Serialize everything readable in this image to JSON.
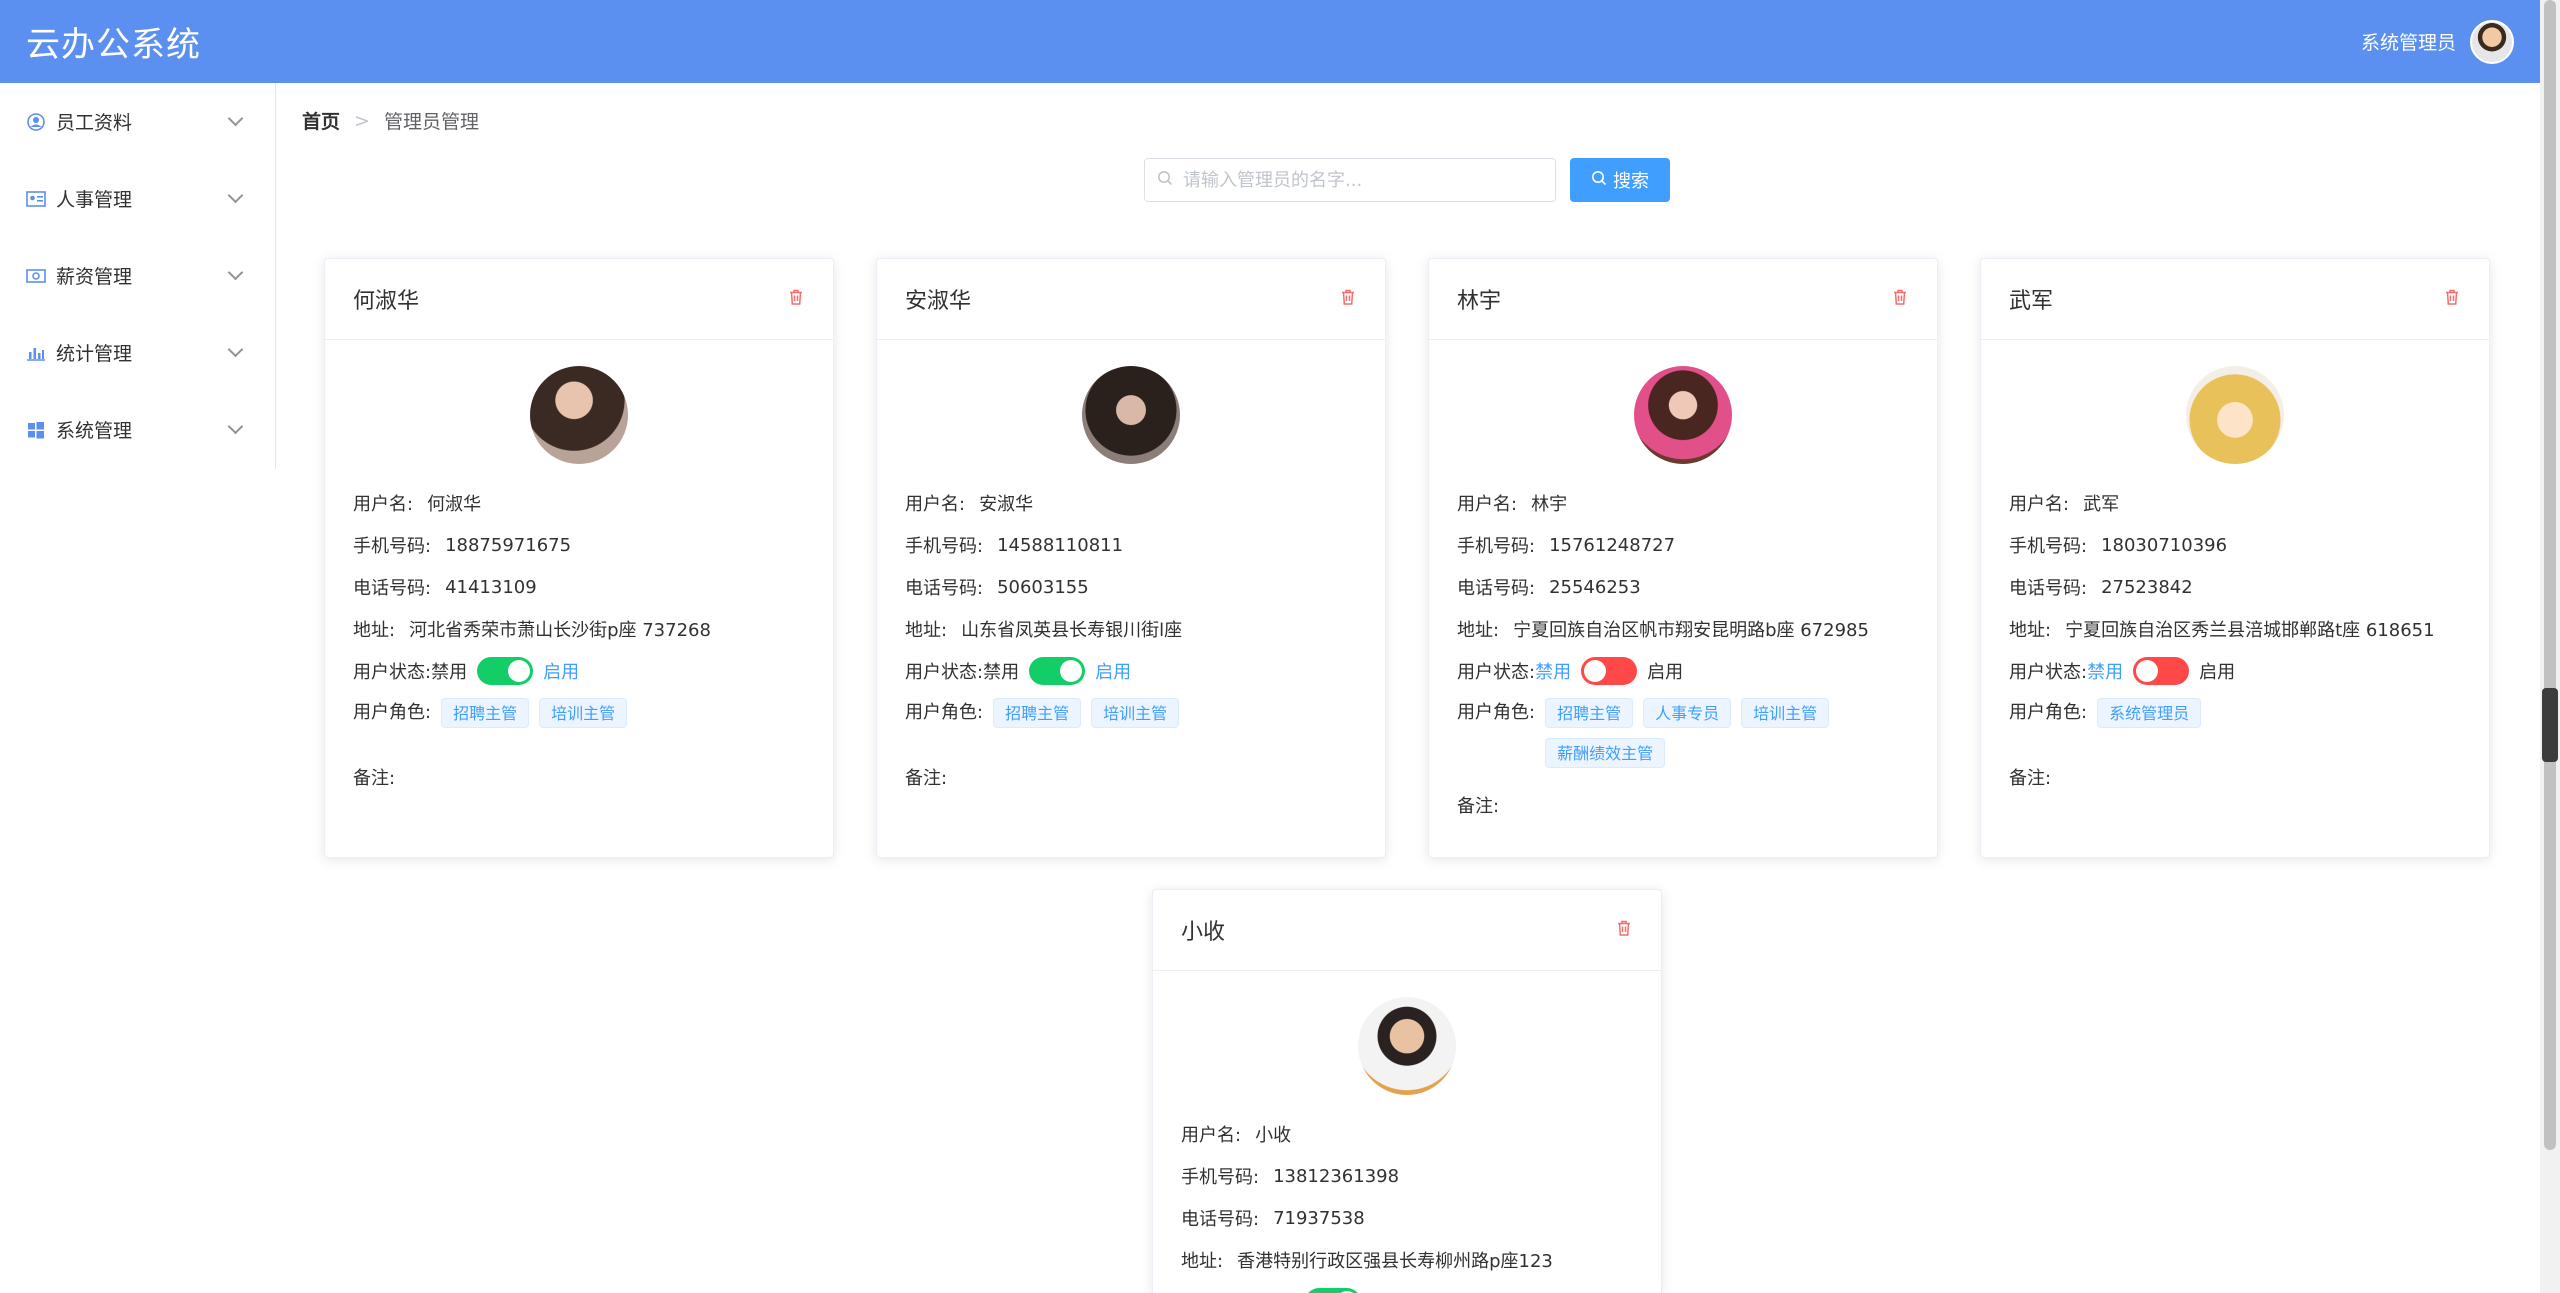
{
  "app": {
    "title": "云办公系统",
    "user_name": "系统管理员"
  },
  "sidebar": {
    "items": [
      {
        "label": "员工资料",
        "icon": "user-circle-icon"
      },
      {
        "label": "人事管理",
        "icon": "id-card-icon"
      },
      {
        "label": "薪资管理",
        "icon": "money-icon"
      },
      {
        "label": "统计管理",
        "icon": "bar-chart-icon"
      },
      {
        "label": "系统管理",
        "icon": "windows-icon"
      }
    ]
  },
  "breadcrumb": {
    "home": "首页",
    "separator": ">",
    "current": "管理员管理"
  },
  "search": {
    "placeholder": "请输入管理员的名字...",
    "value": "",
    "button_label": "搜索"
  },
  "labels": {
    "username": "用户名:",
    "mobile": "手机号码:",
    "phone": "电话号码:",
    "address": "地址:",
    "status": "用户状态:",
    "disabled": "禁用",
    "enabled": "启用",
    "roles": "用户角色:",
    "remark": "备注:"
  },
  "colors": {
    "header": "#5b8ff0",
    "primary": "#409eff",
    "switch_on": "#13ce66",
    "switch_off": "#ff4949",
    "danger": "#f56c6c"
  },
  "admins": [
    {
      "name": "何淑华",
      "username": "何淑华",
      "mobile": "18875971675",
      "phone": "41413109",
      "address": "河北省秀荣市萧山长沙街p座 737268",
      "enabled": true,
      "roles": [
        "招聘主管",
        "培训主管"
      ],
      "remark": ""
    },
    {
      "name": "安淑华",
      "username": "安淑华",
      "mobile": "14588110811",
      "phone": "50603155",
      "address": "山东省凤英县长寿银川街l座",
      "enabled": true,
      "roles": [
        "招聘主管",
        "培训主管"
      ],
      "remark": ""
    },
    {
      "name": "林宇",
      "username": "林宇",
      "mobile": "15761248727",
      "phone": "25546253",
      "address": "宁夏回族自治区帆市翔安昆明路b座 672985",
      "enabled": false,
      "roles": [
        "招聘主管",
        "人事专员",
        "培训主管",
        "薪酬绩效主管"
      ],
      "remark": ""
    },
    {
      "name": "武军",
      "username": "武军",
      "mobile": "18030710396",
      "phone": "27523842",
      "address": "宁夏回族自治区秀兰县涪城邯郸路t座 618651",
      "enabled": false,
      "roles": [
        "系统管理员"
      ],
      "remark": ""
    },
    {
      "name": "小收",
      "username": "小收",
      "mobile": "13812361398",
      "phone": "71937538",
      "address": "香港特别行政区强县长寿柳州路p座123",
      "enabled": true,
      "roles": [],
      "remark": ""
    }
  ]
}
